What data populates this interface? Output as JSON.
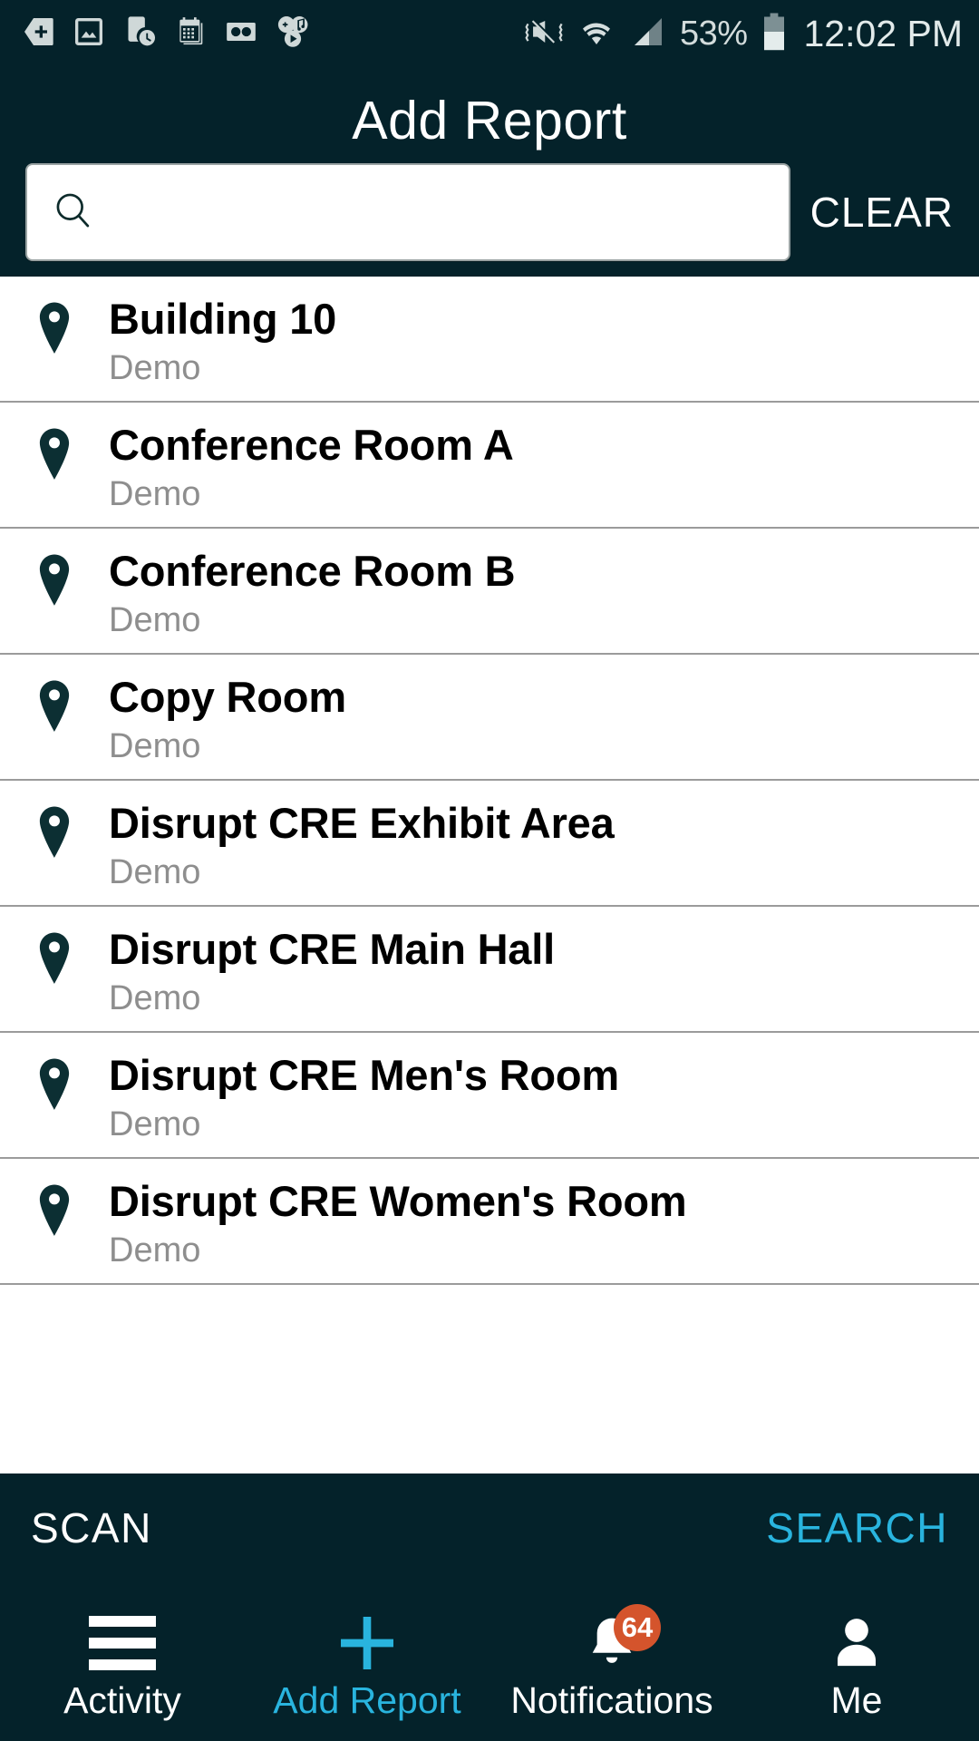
{
  "status_bar": {
    "icons": [
      "tag-plus-icon",
      "photo-icon",
      "phone-clock-icon",
      "calendar-icon",
      "voicemail-icon",
      "game-music-play-icon",
      "mute-vibrate-icon",
      "wifi-icon",
      "cellular-signal-icon"
    ],
    "battery_percent": "53%",
    "clock": "12:02 PM"
  },
  "header": {
    "title": "Add Report",
    "search": {
      "icon": "search-icon",
      "value": "",
      "placeholder": "",
      "clear_label": "CLEAR"
    }
  },
  "list": {
    "item_icon": "map-pin-icon",
    "items": [
      {
        "name": "Building 10",
        "sub": "Demo"
      },
      {
        "name": "Conference Room A",
        "sub": "Demo"
      },
      {
        "name": "Conference Room B",
        "sub": "Demo"
      },
      {
        "name": "Copy Room",
        "sub": "Demo"
      },
      {
        "name": "Disrupt CRE Exhibit Area",
        "sub": "Demo"
      },
      {
        "name": "Disrupt CRE Main Hall",
        "sub": "Demo"
      },
      {
        "name": "Disrupt CRE Men's Room",
        "sub": "Demo"
      },
      {
        "name": "Disrupt CRE Women's Room",
        "sub": "Demo"
      }
    ]
  },
  "action_bar": {
    "scan_label": "SCAN",
    "search_label": "SEARCH"
  },
  "bottom_nav": {
    "items": [
      {
        "label": "Activity",
        "icon": "hamburger-menu-icon",
        "active": false
      },
      {
        "label": "Add Report",
        "icon": "plus-icon",
        "active": true
      },
      {
        "label": "Notifications",
        "icon": "bell-icon",
        "active": false,
        "badge": "64"
      },
      {
        "label": "Me",
        "icon": "person-icon",
        "active": false
      }
    ]
  },
  "colors": {
    "chrome_dark": "#04222a",
    "accent_cyan": "#29b4de",
    "badge_orange": "#d4542c",
    "pin_dark": "#0c2f33",
    "subtitle_gray": "#8e8e8e",
    "divider_gray": "#9b9b9b"
  }
}
